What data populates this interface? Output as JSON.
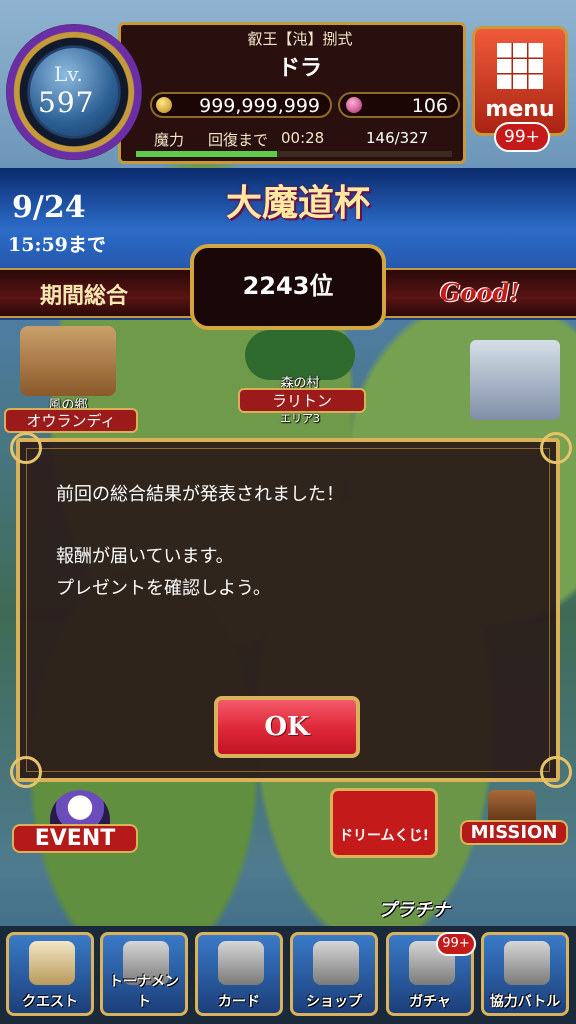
{
  "player": {
    "title": "叡王【沌】捌式",
    "name": "ドラ",
    "level_label": "Lv.",
    "level": "597",
    "gold": "999,999,999",
    "gems": "106",
    "mana_label": "魔力",
    "recovery_label": "回復まで",
    "recovery_time": "00:28",
    "mana": "146/327",
    "mana_fraction": 0.446
  },
  "menu": {
    "label": "menu",
    "badge": "99+"
  },
  "event_banner": {
    "deadline_date": "9/24",
    "deadline_time": "15:59まで",
    "event_name": "大魔道杯",
    "period_label": "期間総合",
    "rank": "2243位",
    "grade": "Good!"
  },
  "map": {
    "area1_name": "風の郷",
    "area1_sign": "オウランディ",
    "area2_name": "森の村",
    "area2_sign": "ラリトン",
    "area2_sub": "エリア3"
  },
  "dialog": {
    "line1": "前回の総合結果が発表されました！",
    "line2": "報酬が届いています。",
    "line3": "プレゼントを確認しよう。",
    "ok_label": "OK"
  },
  "bottom": {
    "event_label": "EVENT",
    "dream_label": "ドリームくじ!",
    "mission_label": "MISSION",
    "platinum_label": "プラチナ",
    "gacha_badge": "99+",
    "nav": {
      "quest": "クエスト",
      "tournament": "トーナメント",
      "card": "カード",
      "shop": "ショップ",
      "gacha": "ガチャ",
      "coop": "協力バトル"
    }
  }
}
